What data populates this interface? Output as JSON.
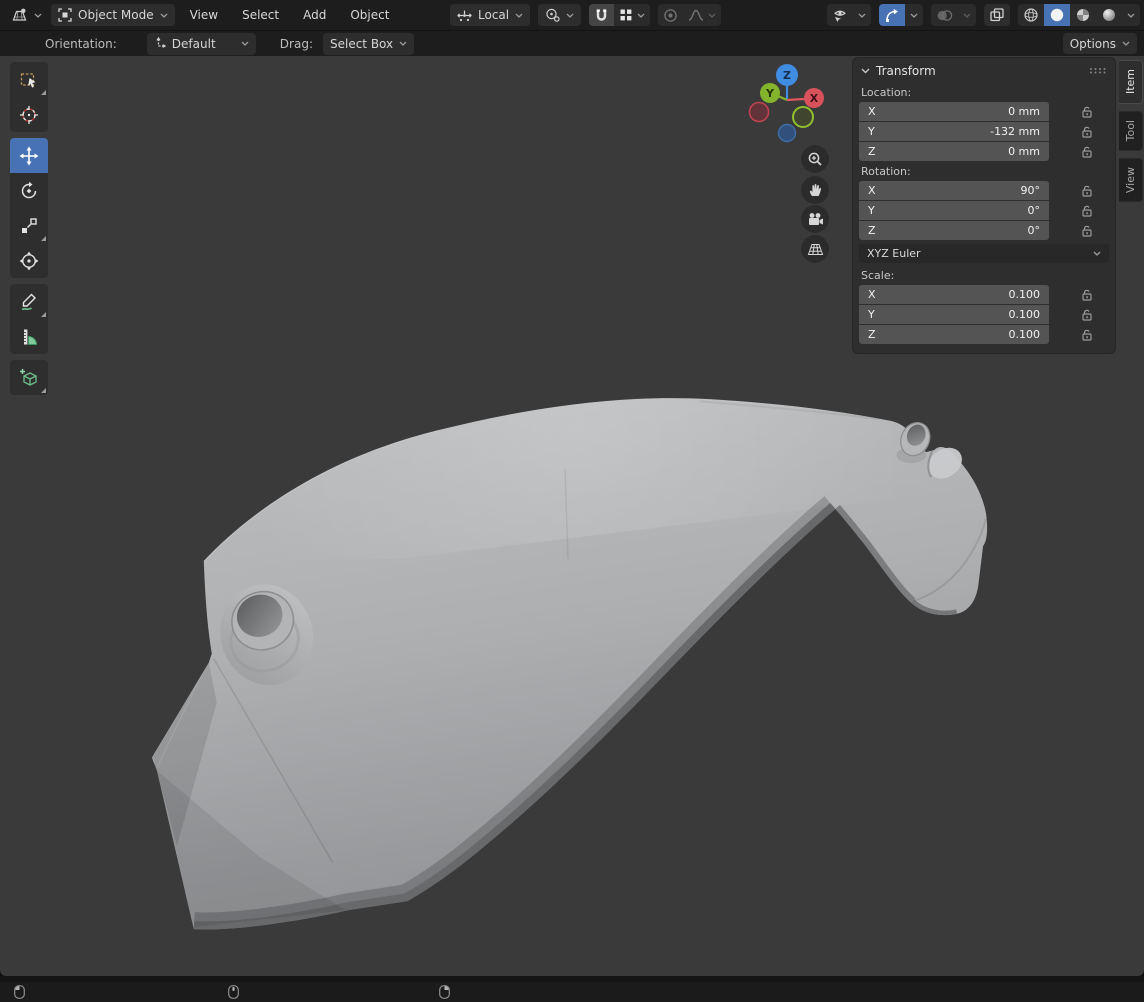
{
  "header": {
    "mode_label": "Object Mode",
    "menus": [
      "View",
      "Select",
      "Add",
      "Object"
    ],
    "orientation_value": "Local",
    "options_label": "Options"
  },
  "tool_settings": {
    "orientation_label": "Orientation:",
    "orientation_value": "Default",
    "drag_label": "Drag:",
    "drag_value": "Select Box"
  },
  "toolbar": {
    "active_tool": "move",
    "tools": [
      "select-box",
      "cursor",
      "move",
      "rotate",
      "scale",
      "transform",
      "annotate",
      "measure",
      "add-cube"
    ]
  },
  "sidebar": {
    "tabs": [
      {
        "label": "Item",
        "active": true
      },
      {
        "label": "Tool",
        "active": false
      },
      {
        "label": "View",
        "active": false
      }
    ],
    "panel": {
      "title": "Transform",
      "location": {
        "label": "Location:",
        "rows": [
          {
            "axis": "X",
            "value": "0 mm"
          },
          {
            "axis": "Y",
            "value": "-132 mm"
          },
          {
            "axis": "Z",
            "value": "0 mm"
          }
        ]
      },
      "rotation": {
        "label": "Rotation:",
        "rows": [
          {
            "axis": "X",
            "value": "90°"
          },
          {
            "axis": "Y",
            "value": "0°"
          },
          {
            "axis": "Z",
            "value": "0°"
          }
        ],
        "mode": "XYZ Euler"
      },
      "scale": {
        "label": "Scale:",
        "rows": [
          {
            "axis": "X",
            "value": "0.100"
          },
          {
            "axis": "Y",
            "value": "0.100"
          },
          {
            "axis": "Z",
            "value": "0.100"
          }
        ]
      }
    }
  },
  "gizmo": {
    "axis_labels": {
      "x": "X",
      "y": "Y",
      "z": "Z"
    }
  },
  "colors": {
    "accent": "#4772b3",
    "header_bg": "#1d1d1d",
    "viewport_bg": "#3a3a3b",
    "panel_bg": "#2e2e2e",
    "field_bg": "#545454",
    "model_light": "#b4b6b8",
    "model_shadow": "#6d6f71",
    "axis_x": "#e0565e",
    "axis_y": "#84b32c",
    "axis_z": "#3f8ce0"
  }
}
